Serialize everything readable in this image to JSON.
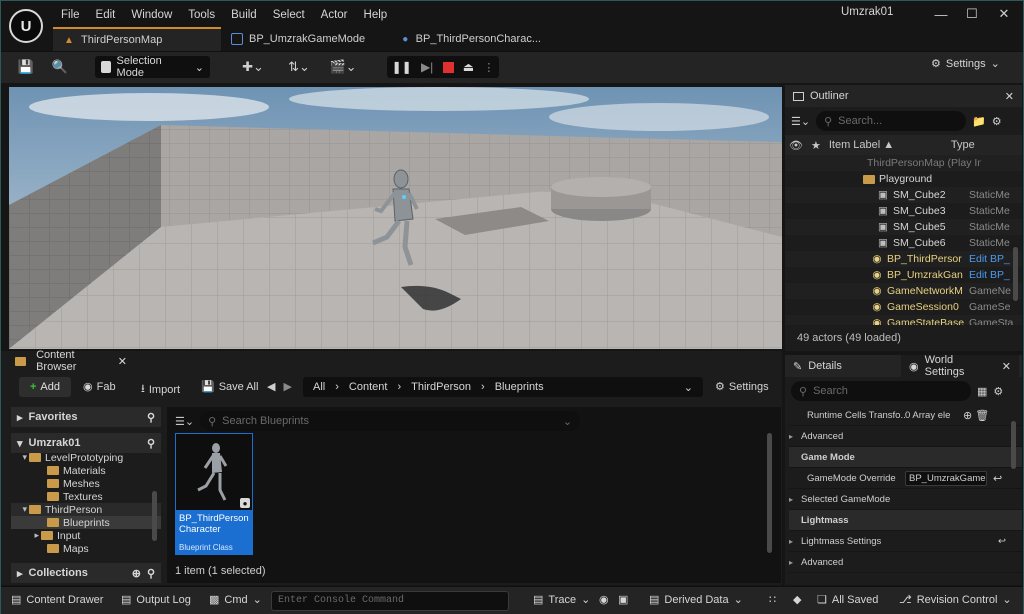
{
  "menu": [
    "File",
    "Edit",
    "Window",
    "Tools",
    "Build",
    "Select",
    "Actor",
    "Help"
  ],
  "project_name": "Umzrak01",
  "tabs": [
    {
      "label": "ThirdPersonMap",
      "icon": "level-icon"
    },
    {
      "label": "BP_UmzrakGameMode",
      "icon": "blueprint-icon"
    },
    {
      "label": "BP_ThirdPersonCharac...",
      "icon": "character-icon"
    }
  ],
  "toolbar": {
    "selection_mode": "Selection Mode",
    "settings": "Settings"
  },
  "outliner": {
    "tab_title": "Outliner",
    "search_placeholder": "Search...",
    "col_label": "Item Label ▲",
    "col_type": "Type",
    "rows": [
      {
        "label": "ThirdPersonMap (Play In Ed",
        "type": ""
      },
      {
        "label": "Playground",
        "type": ""
      },
      {
        "label": "SM_Cube2",
        "type": "StaticMe"
      },
      {
        "label": "SM_Cube3",
        "type": "StaticMe"
      },
      {
        "label": "SM_Cube5",
        "type": "StaticMe"
      },
      {
        "label": "SM_Cube6",
        "type": "StaticMe"
      },
      {
        "label": "BP_ThirdPersor",
        "type": "Edit BP_"
      },
      {
        "label": "BP_UmzrakGan",
        "type": "Edit BP_"
      },
      {
        "label": "GameNetworkM",
        "type": "GameNe"
      },
      {
        "label": "GameSession0",
        "type": "GameSe"
      },
      {
        "label": "GameStateBase",
        "type": "GameSta"
      }
    ],
    "footer": "49 actors (49 loaded)"
  },
  "content_browser": {
    "tab_title": "Content Browser",
    "add": "Add",
    "fab": "Fab",
    "import": "Import",
    "save_all": "Save All",
    "path": [
      "All",
      "Content",
      "ThirdPerson",
      "Blueprints"
    ],
    "settings": "Settings",
    "favorites": "Favorites",
    "project": "Umzrak01",
    "tree": [
      "LevelPrototyping",
      "Materials",
      "Meshes",
      "Textures",
      "ThirdPerson",
      "Blueprints",
      "Input",
      "Maps"
    ],
    "collections": "Collections",
    "search_placeholder": "Search Blueprints",
    "asset_name": "BP_ThirdPerson\nCharacter",
    "asset_class": "Blueprint Class",
    "count": "1 item (1 selected)"
  },
  "details": {
    "tab_details": "Details",
    "tab_world": "World Settings",
    "search_placeholder": "Search",
    "rows": [
      {
        "k": "Runtime Cells Transfo...",
        "v": "0 Array ele",
        "type": "prop"
      },
      {
        "k": "Advanced",
        "v": "",
        "type": "sub"
      },
      {
        "k": "Game Mode",
        "v": "",
        "type": "section"
      },
      {
        "k": "GameMode Override",
        "v": "BP_UmzrakGameM",
        "type": "prop"
      },
      {
        "k": "Selected GameMode",
        "v": "",
        "type": "sub"
      },
      {
        "k": "Lightmass",
        "v": "",
        "type": "section"
      },
      {
        "k": "Lightmass Settings",
        "v": "",
        "type": "sub"
      },
      {
        "k": "Advanced",
        "v": "",
        "type": "sub"
      }
    ]
  },
  "statusbar": {
    "content_drawer": "Content Drawer",
    "output_log": "Output Log",
    "cmd": "Cmd",
    "console_placeholder": "Enter Console Command",
    "trace": "Trace",
    "derived_data": "Derived Data",
    "all_saved": "All Saved",
    "revision_control": "Revision Control"
  },
  "colors": {
    "accent": "#d28a2a",
    "selection": "#1a6fd0",
    "folder": "#c89a4a"
  }
}
